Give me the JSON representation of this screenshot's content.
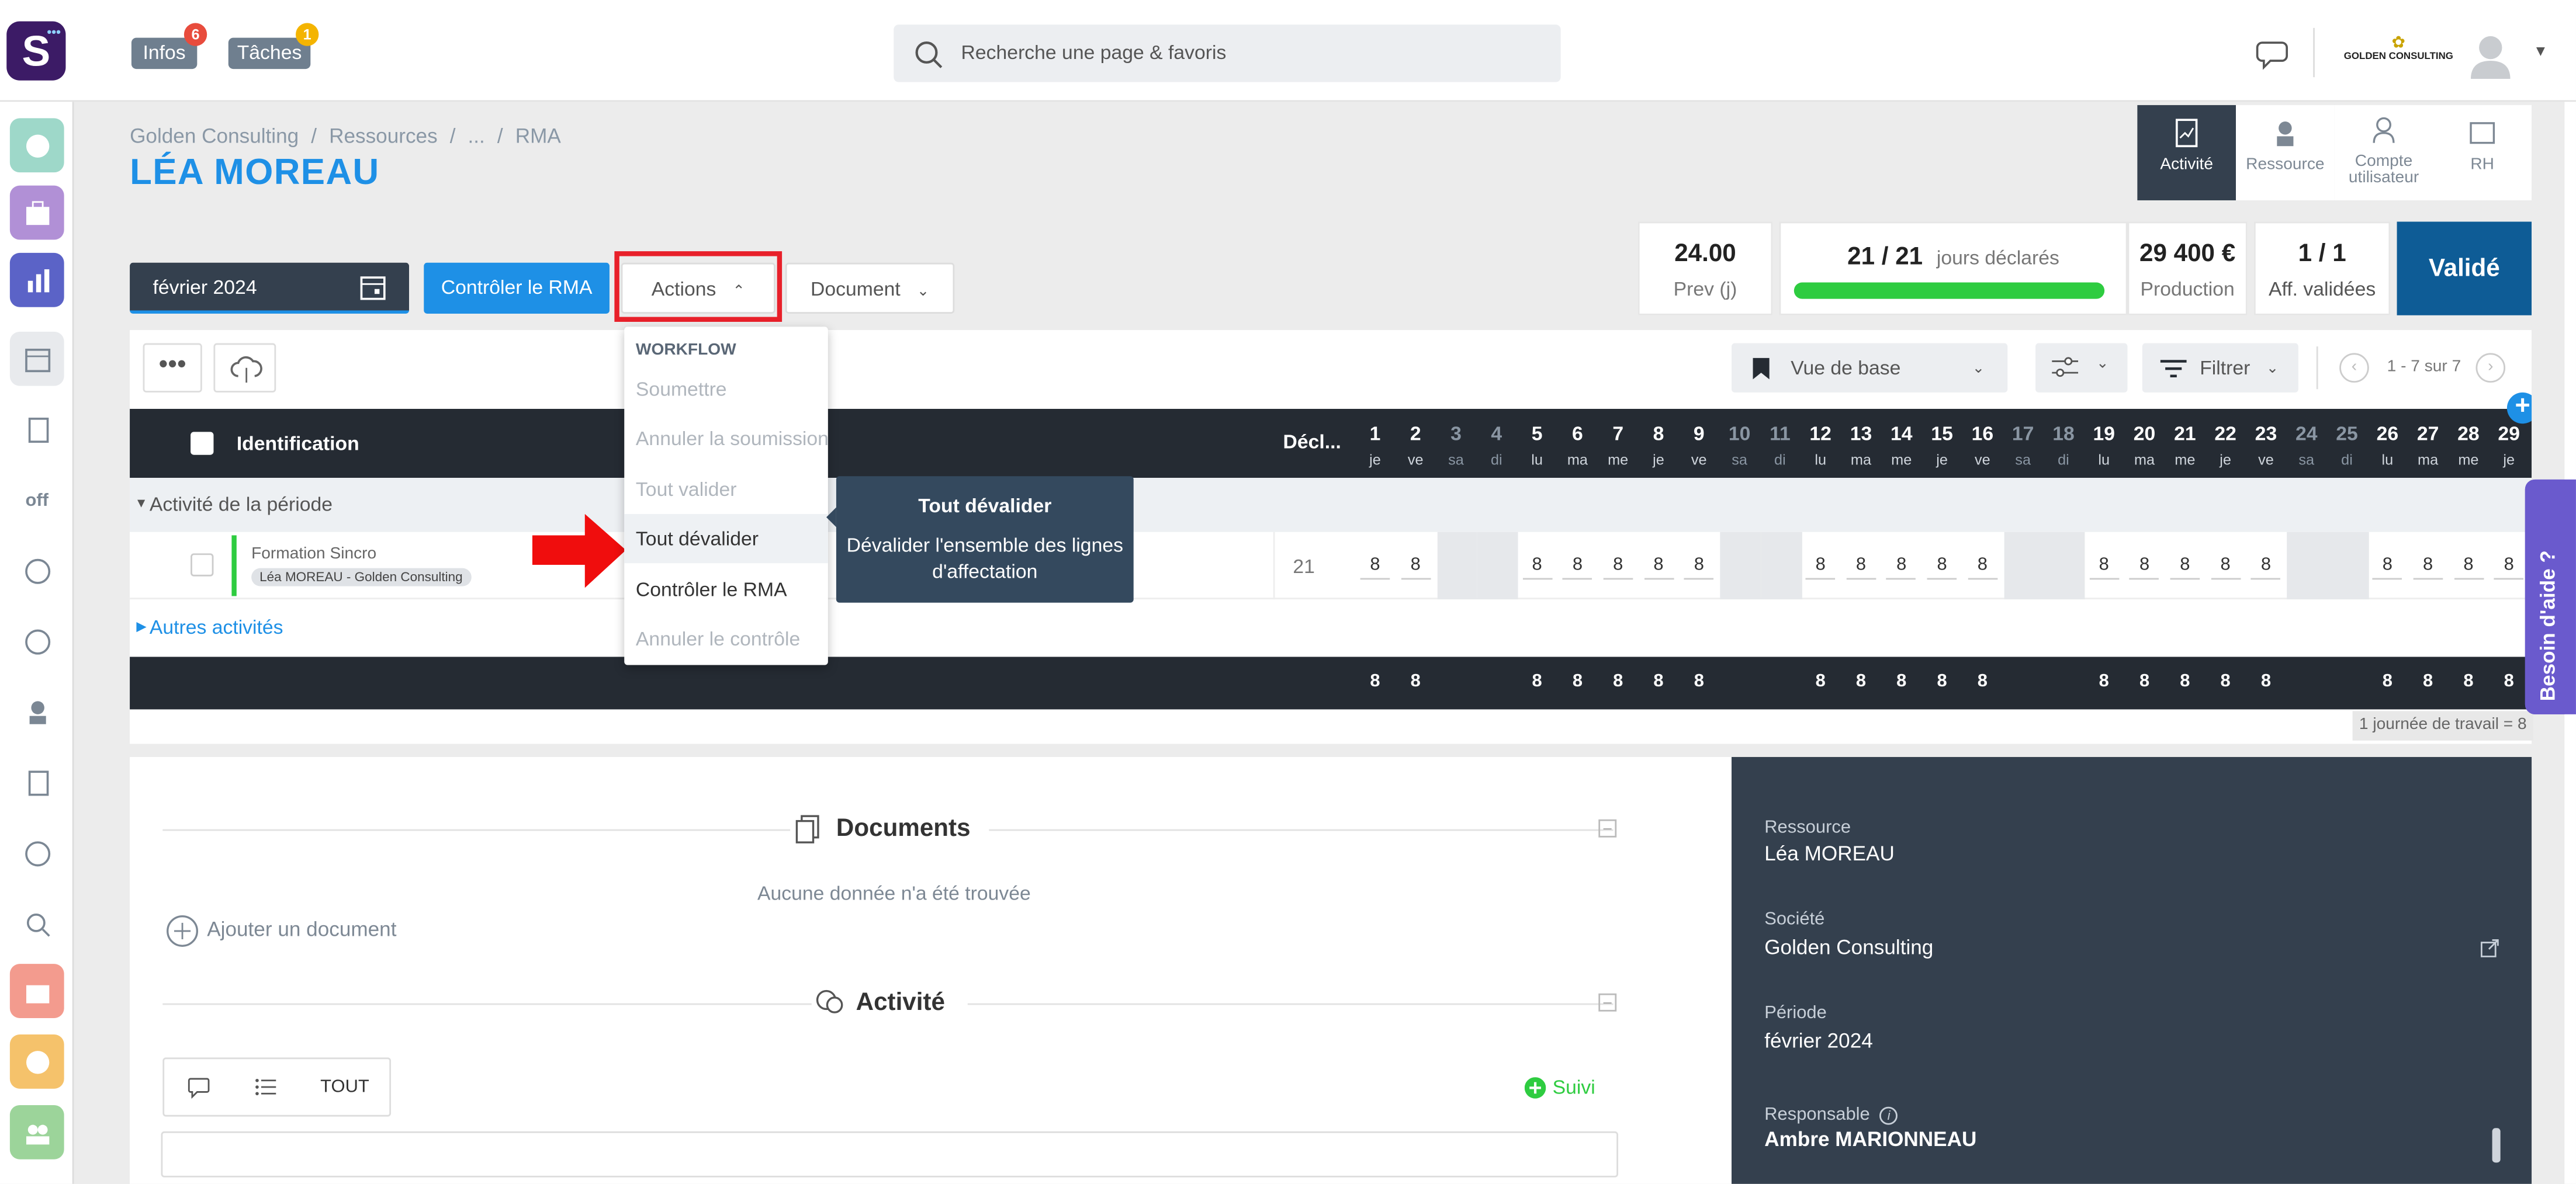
{
  "header": {
    "logo_letter": "S",
    "infos_label": "Infos",
    "infos_count": "6",
    "tasks_label": "Tâches",
    "tasks_count": "1",
    "search_placeholder": "Recherche une page & favoris",
    "company_logo_text": "GOLDEN CONSULTING"
  },
  "breadcrumb": [
    "Golden Consulting",
    "Ressources",
    "...",
    "RMA"
  ],
  "page_title": "LÉA MOREAU",
  "right_tabs": [
    {
      "label": "Activité",
      "icon": "chart-doc-icon",
      "active": true
    },
    {
      "label": "Ressource",
      "icon": "person-icon",
      "active": false
    },
    {
      "label": "Compte utilisateur",
      "icon": "user-account-icon",
      "active": false
    },
    {
      "label": "RH",
      "icon": "folder-icon",
      "active": false
    }
  ],
  "stats": {
    "prev_value": "24.00",
    "prev_label": "Prev (j)",
    "days_value": "21 / 21",
    "days_label": "jours déclarés",
    "days_progress": 1.0,
    "production_value": "29 400 €",
    "production_label": "Production",
    "aff_value": "1 / 1",
    "aff_label": "Aff. validées",
    "status": "Validé"
  },
  "toolbar": {
    "period": "février 2024",
    "control_button": "Contrôler le RMA",
    "actions_button": "Actions",
    "document_button": "Document",
    "view_select": "Vue de base",
    "filter_button": "Filtrer",
    "pagination": "1 - 7 sur 7"
  },
  "actions_menu": {
    "section": "WORKFLOW",
    "items": [
      {
        "label": "Soumettre",
        "enabled": false
      },
      {
        "label": "Annuler la soumission",
        "enabled": false
      },
      {
        "label": "Tout valider",
        "enabled": false
      },
      {
        "label": "Tout dévalider",
        "enabled": true
      },
      {
        "label": "Contrôler le RMA",
        "enabled": true
      },
      {
        "label": "Annuler le contrôle",
        "enabled": false
      }
    ]
  },
  "tooltip": {
    "title": "Tout dévalider",
    "text": "Dévalider l'ensemble des lignes d'affectation"
  },
  "table": {
    "col_identification": "Identification",
    "col_declared": "Décl...",
    "days": [
      {
        "n": "1",
        "d": "je",
        "w": false
      },
      {
        "n": "2",
        "d": "ve",
        "w": false
      },
      {
        "n": "3",
        "d": "sa",
        "w": true
      },
      {
        "n": "4",
        "d": "di",
        "w": true
      },
      {
        "n": "5",
        "d": "lu",
        "w": false
      },
      {
        "n": "6",
        "d": "ma",
        "w": false
      },
      {
        "n": "7",
        "d": "me",
        "w": false
      },
      {
        "n": "8",
        "d": "je",
        "w": false
      },
      {
        "n": "9",
        "d": "ve",
        "w": false
      },
      {
        "n": "10",
        "d": "sa",
        "w": true
      },
      {
        "n": "11",
        "d": "di",
        "w": true
      },
      {
        "n": "12",
        "d": "lu",
        "w": false
      },
      {
        "n": "13",
        "d": "ma",
        "w": false
      },
      {
        "n": "14",
        "d": "me",
        "w": false
      },
      {
        "n": "15",
        "d": "je",
        "w": false
      },
      {
        "n": "16",
        "d": "ve",
        "w": false
      },
      {
        "n": "17",
        "d": "sa",
        "w": true
      },
      {
        "n": "18",
        "d": "di",
        "w": true
      },
      {
        "n": "19",
        "d": "lu",
        "w": false
      },
      {
        "n": "20",
        "d": "ma",
        "w": false
      },
      {
        "n": "21",
        "d": "me",
        "w": false
      },
      {
        "n": "22",
        "d": "je",
        "w": false
      },
      {
        "n": "23",
        "d": "ve",
        "w": false
      },
      {
        "n": "24",
        "d": "sa",
        "w": true
      },
      {
        "n": "25",
        "d": "di",
        "w": true
      },
      {
        "n": "26",
        "d": "lu",
        "w": false
      },
      {
        "n": "27",
        "d": "ma",
        "w": false
      },
      {
        "n": "28",
        "d": "me",
        "w": false
      },
      {
        "n": "29",
        "d": "je",
        "w": false
      }
    ],
    "group_period": "Activité de la période",
    "row": {
      "title": "Formation Sincro",
      "tag": "Léa MOREAU - Golden Consulting",
      "declared": "21",
      "hours": [
        "8",
        "8",
        "",
        "",
        "8",
        "8",
        "8",
        "8",
        "8",
        "",
        "",
        "8",
        "8",
        "8",
        "8",
        "8",
        "",
        "",
        "8",
        "8",
        "8",
        "8",
        "8",
        "",
        "",
        "8",
        "8",
        "8",
        "8"
      ]
    },
    "group_other": "Autres activités",
    "totals": [
      "8",
      "8",
      "",
      "",
      "8",
      "8",
      "8",
      "8",
      "8",
      "",
      "",
      "8",
      "8",
      "8",
      "8",
      "8",
      "",
      "",
      "8",
      "8",
      "8",
      "8",
      "8",
      "",
      "",
      "8",
      "8",
      "8",
      "8"
    ],
    "workday_note": "1 journée de travail = 8"
  },
  "documents": {
    "title": "Documents",
    "empty": "Aucune donnée n'a été trouvée",
    "add": "Ajouter un document"
  },
  "activity": {
    "title": "Activité",
    "tab_all": "TOUT",
    "follow": "Suivi"
  },
  "info_panel": {
    "resource_label": "Ressource",
    "resource_value": "Léa MOREAU",
    "company_label": "Société",
    "company_value": "Golden Consulting",
    "period_label": "Période",
    "period_value": "février 2024",
    "manager_label": "Responsable",
    "manager_value": "Ambre MARIONNEAU"
  },
  "help_tab": "Besoin d'aide ?",
  "colors": {
    "accent": "#1e90e6",
    "dark": "#252b33",
    "validated": "#0e5c96",
    "highlight": "#e8202a"
  }
}
